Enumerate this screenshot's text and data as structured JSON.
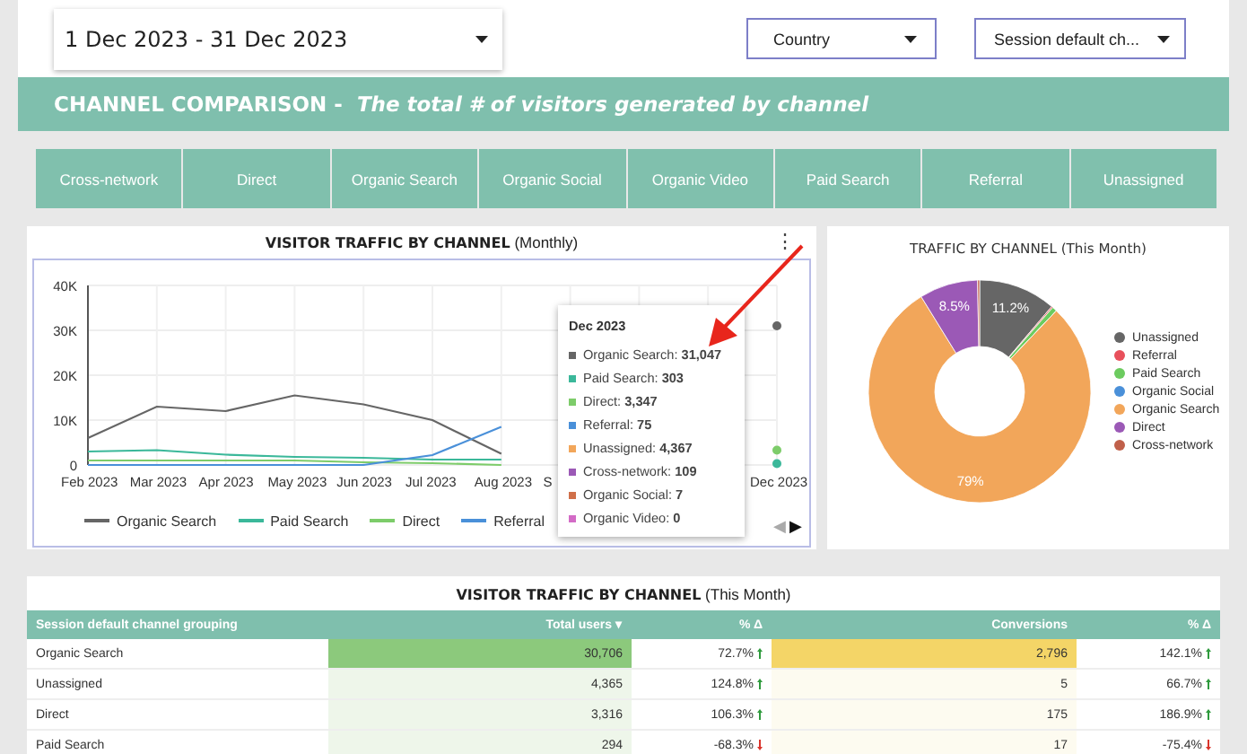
{
  "date_range": {
    "value": "1 Dec 2023 - 31 Dec 2023"
  },
  "filters": [
    {
      "label": "Country"
    },
    {
      "label": "Session default ch..."
    }
  ],
  "banner": {
    "title": "CHANNEL COMPARISON - ",
    "subtitle": "The total # of visitors generated by channel"
  },
  "channel_chips": [
    "Cross-network",
    "Direct",
    "Organic Search",
    "Organic Social",
    "Organic Video",
    "Paid Search",
    "Referral",
    "Unassigned"
  ],
  "line_card": {
    "title": "VISITOR TRAFFIC BY CHANNEL",
    "subtitle": "(Monthly)",
    "menu": "⋮",
    "chart_data": {
      "type": "line",
      "grid": true,
      "categories": [
        "Feb 2023",
        "Mar 2023",
        "Apr 2023",
        "May 2023",
        "Jun 2023",
        "Jul 2023",
        "Aug 2023",
        "S",
        null,
        null,
        "Dec 2023"
      ],
      "series": [
        {
          "name": "Organic Search",
          "color": "#666666",
          "values": [
            6000,
            13000,
            12000,
            15500,
            13500,
            10000,
            2500,
            null,
            null,
            null,
            31000
          ]
        },
        {
          "name": "Paid Search",
          "color": "#3bb89a",
          "values": [
            3000,
            3300,
            2300,
            1800,
            1600,
            1200,
            1200,
            null,
            null,
            null,
            300
          ]
        },
        {
          "name": "Direct",
          "color": "#7dcc6a",
          "values": [
            1000,
            1000,
            1000,
            1000,
            600,
            400,
            0,
            null,
            null,
            null,
            3300
          ]
        },
        {
          "name": "Referral",
          "color": "#4a90d9",
          "values": [
            0,
            0,
            0,
            0,
            0,
            2200,
            8500,
            null,
            null,
            null,
            null
          ]
        }
      ],
      "ylim": [
        0,
        40000
      ],
      "yticks": [
        {
          "value": 0,
          "label": "0"
        },
        {
          "value": 10000,
          "label": "10K"
        },
        {
          "value": 20000,
          "label": "20K"
        },
        {
          "value": 30000,
          "label": "30K"
        },
        {
          "value": 40000,
          "label": "40K"
        }
      ]
    },
    "legend_pager": [
      {
        "label": "◀",
        "disabled": true
      },
      {
        "label": "▶",
        "disabled": false
      }
    ],
    "tooltip": {
      "title": "Dec 2023",
      "items": [
        {
          "label": "Organic Search: ",
          "value": "31,047",
          "color": "#666666"
        },
        {
          "label": "Paid Search: ",
          "value": "303",
          "color": "#3bb89a"
        },
        {
          "label": "Direct: ",
          "value": "3,347",
          "color": "#7dcc6a"
        },
        {
          "label": "Referral: ",
          "value": "75",
          "color": "#4a90d9"
        },
        {
          "label": "Unassigned: ",
          "value": "4,367",
          "color": "#f2a65a"
        },
        {
          "label": "Cross-network: ",
          "value": "109",
          "color": "#9b59b6"
        },
        {
          "label": "Organic Social: ",
          "value": "7",
          "color": "#d0704a"
        },
        {
          "label": "Organic Video: ",
          "value": "0",
          "color": "#d36bc6"
        }
      ]
    }
  },
  "pie_card": {
    "title": "TRAFFIC BY CHANNEL (This Month)",
    "chart_data": {
      "type": "donut",
      "categories": [
        "Unassigned",
        "Referral",
        "Paid Search",
        "Organic Social",
        "Organic Search",
        "Direct",
        "Cross-network"
      ],
      "values": [
        11.2,
        0.2,
        0.7,
        null,
        79,
        8.5,
        0.3
      ],
      "colors": [
        "#666666",
        "#e8505b",
        "#6ccb5f",
        "#4a90d9",
        "#f2a65a",
        "#9b59b6",
        "#c0604a"
      ],
      "value_labels": [
        "11.2%",
        null,
        null,
        null,
        "79%",
        "8.5%",
        null
      ]
    }
  },
  "table": {
    "title": "VISITOR TRAFFIC BY CHANNEL",
    "subtitle": "(This Month)",
    "columns": [
      {
        "label": "Session default channel grouping",
        "kind": "text"
      },
      {
        "label": "Total users ▾",
        "kind": "heat_green"
      },
      {
        "label": "% Δ",
        "kind": "delta"
      },
      {
        "label": "Conversions",
        "kind": "heat_yellow"
      },
      {
        "label": "% Δ",
        "kind": "delta"
      }
    ],
    "rows": [
      {
        "highlighted": true,
        "cells": [
          {
            "text": "Organic Search"
          },
          {
            "text": "30,706"
          },
          {
            "text": "72.7%",
            "increase": true
          },
          {
            "text": "2,796"
          },
          {
            "text": "142.1%",
            "increase": true
          }
        ]
      },
      {
        "highlighted": false,
        "cells": [
          {
            "text": "Unassigned"
          },
          {
            "text": "4,365"
          },
          {
            "text": "124.8%",
            "increase": true
          },
          {
            "text": "5"
          },
          {
            "text": "66.7%",
            "increase": true
          }
        ]
      },
      {
        "highlighted": false,
        "cells": [
          {
            "text": "Direct"
          },
          {
            "text": "3,316"
          },
          {
            "text": "106.3%",
            "increase": true
          },
          {
            "text": "175"
          },
          {
            "text": "186.9%",
            "increase": true
          }
        ]
      },
      {
        "highlighted": false,
        "cells": [
          {
            "text": "Paid Search"
          },
          {
            "text": "294"
          },
          {
            "text": "-68.3%",
            "increase": false
          },
          {
            "text": "17"
          },
          {
            "text": "-75.4%",
            "increase": false
          }
        ]
      }
    ]
  }
}
